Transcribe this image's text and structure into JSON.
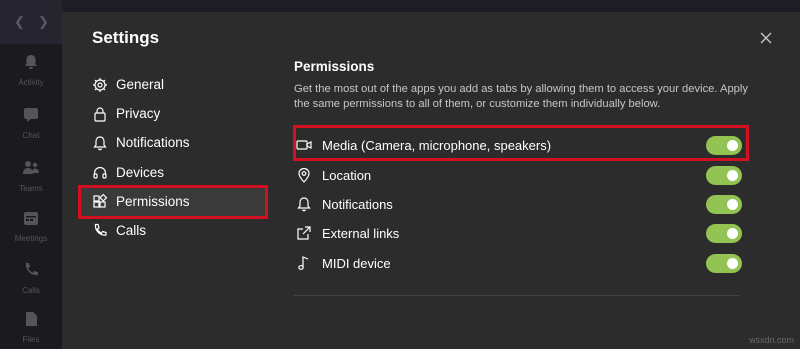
{
  "rail": {
    "items": [
      {
        "label": "Activity",
        "icon": "bell-icon"
      },
      {
        "label": "Chat",
        "icon": "chat-icon"
      },
      {
        "label": "Teams",
        "icon": "teams-icon"
      },
      {
        "label": "Meetings",
        "icon": "calendar-icon"
      },
      {
        "label": "Calls",
        "icon": "phone-icon"
      },
      {
        "label": "Files",
        "icon": "file-icon"
      }
    ]
  },
  "settings": {
    "title": "Settings",
    "menu": [
      {
        "label": "General",
        "icon": "gear-icon"
      },
      {
        "label": "Privacy",
        "icon": "lock-icon"
      },
      {
        "label": "Notifications",
        "icon": "bell-icon"
      },
      {
        "label": "Devices",
        "icon": "headset-icon"
      },
      {
        "label": "Permissions",
        "icon": "apps-icon",
        "selected": true
      },
      {
        "label": "Calls",
        "icon": "phone-icon"
      }
    ]
  },
  "permissions": {
    "title": "Permissions",
    "description": "Get the most out of the apps you add as tabs by allowing them to access your device. Apply the same permissions to all of them, or customize them individually below.",
    "items": [
      {
        "label": "Media (Camera, microphone, speakers)",
        "icon": "camera-icon",
        "enabled": true
      },
      {
        "label": "Location",
        "icon": "location-pin-icon",
        "enabled": true
      },
      {
        "label": "Notifications",
        "icon": "bell-icon",
        "enabled": true
      },
      {
        "label": "External links",
        "icon": "external-link-icon",
        "enabled": true
      },
      {
        "label": "MIDI device",
        "icon": "music-note-icon",
        "enabled": true
      }
    ]
  },
  "colors": {
    "toggle_on": "#92c353",
    "highlight": "#d31022",
    "background": "#2d2c2c"
  },
  "watermark": "wsxdn.com"
}
